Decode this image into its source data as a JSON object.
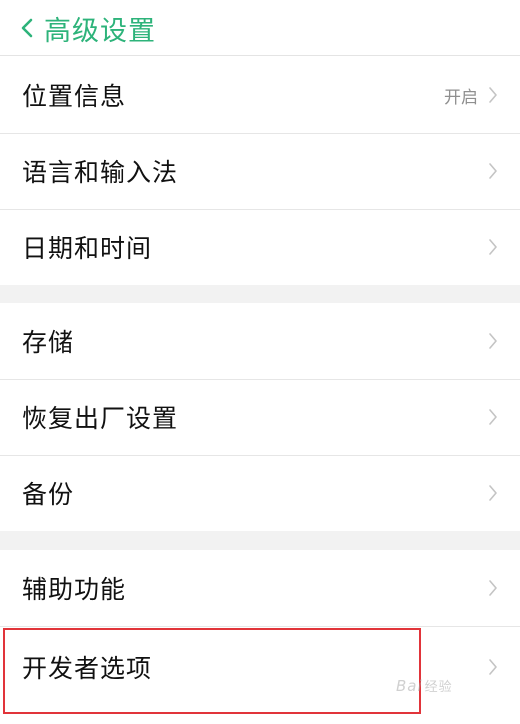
{
  "colors": {
    "accent": "#2db37a",
    "highlight_border": "#e1343a",
    "chevron": "#c4c4c4",
    "value_text": "#8f8f8f"
  },
  "header": {
    "back_icon": "chevron-left-icon",
    "title": "高级设置"
  },
  "groups": [
    {
      "items": [
        {
          "label": "位置信息",
          "value": "开启",
          "icon": "chevron-right-icon"
        },
        {
          "label": "语言和输入法",
          "value": "",
          "icon": "chevron-right-icon"
        },
        {
          "label": "日期和时间",
          "value": "",
          "icon": "chevron-right-icon"
        }
      ]
    },
    {
      "items": [
        {
          "label": "存储",
          "value": "",
          "icon": "chevron-right-icon"
        },
        {
          "label": "恢复出厂设置",
          "value": "",
          "icon": "chevron-right-icon"
        },
        {
          "label": "备份",
          "value": "",
          "icon": "chevron-right-icon"
        }
      ]
    },
    {
      "items": [
        {
          "label": "辅助功能",
          "value": "",
          "icon": "chevron-right-icon"
        },
        {
          "label": "开发者选项",
          "value": "",
          "icon": "chevron-right-icon",
          "highlighted": true
        }
      ]
    }
  ],
  "watermark": {
    "text": "Bai",
    "sub": "经验"
  }
}
